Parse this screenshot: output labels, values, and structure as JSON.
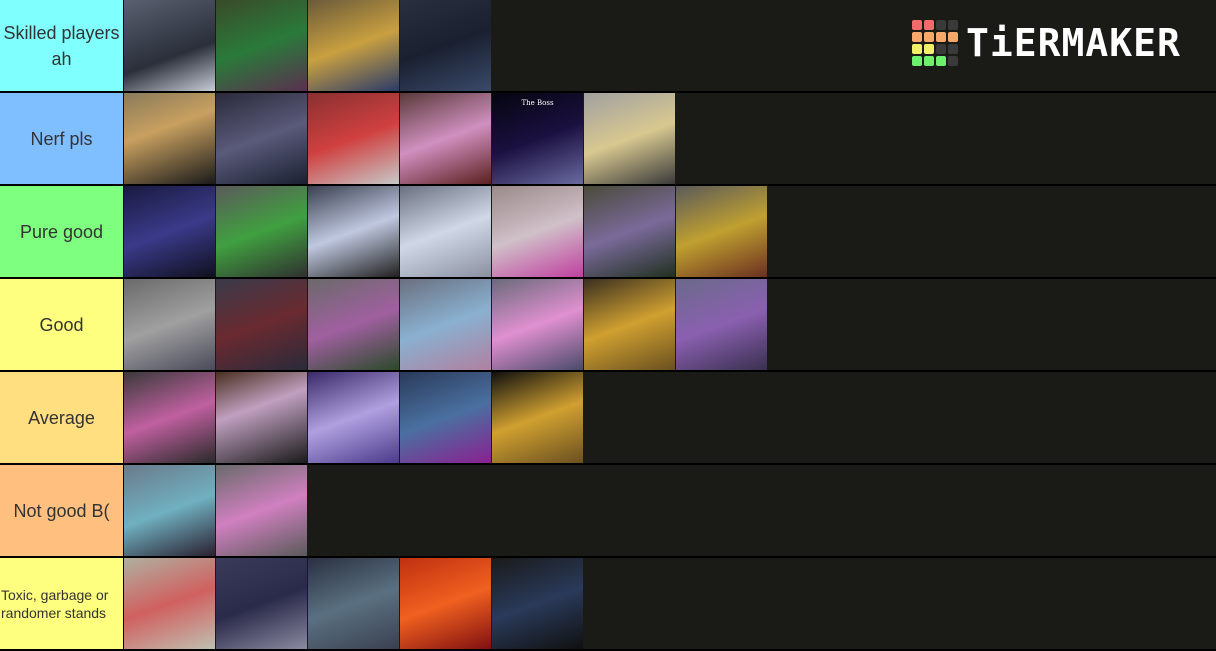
{
  "logo": {
    "text": "TiERMAKER",
    "grid_colors": [
      "#f26b6b",
      "#f26b6b",
      "#3a3a3a",
      "#3a3a3a",
      "#f7a86a",
      "#f7a86a",
      "#f7a86a",
      "#f7a86a",
      "#f2f06a",
      "#f2f06a",
      "#3a3a3a",
      "#3a3a3a",
      "#6df06d",
      "#6df06d",
      "#6df06d",
      "#3a3a3a"
    ]
  },
  "tiers": [
    {
      "label": "Skilled players ah",
      "color": "#80ffff",
      "items": [
        {
          "name": "stand-1",
          "bg": "linear-gradient(160deg,#5a6070,#2a2f3a 60%,#c8ccd6)"
        },
        {
          "name": "stand-2",
          "bg": "linear-gradient(160deg,#3a4a2a,#2a7a3a 50%,#5a3050)"
        },
        {
          "name": "stand-3",
          "bg": "linear-gradient(160deg,#6a5a3a,#c9a040 50%,#2a3a6a)"
        },
        {
          "name": "stand-4",
          "bg": "linear-gradient(160deg,#2a2f40,#1a2030 50%,#3a4a6a)"
        }
      ]
    },
    {
      "label": "Nerf pls",
      "color": "#80bfff",
      "items": [
        {
          "name": "stand-5",
          "bg": "linear-gradient(160deg,#8a7a5a,#c8a060 40%,#1a1a1a)"
        },
        {
          "name": "stand-6",
          "bg": "linear-gradient(160deg,#2a2a3a,#5a5a7a 50%,#1a2030)"
        },
        {
          "name": "stand-7",
          "bg": "linear-gradient(160deg,#8a3030,#d04040 50%,#c8c8c8)"
        },
        {
          "name": "stand-8",
          "bg": "linear-gradient(160deg,#5a3a3a,#d090c0 50%,#5a2020)"
        },
        {
          "name": "stand-9",
          "bg": "linear-gradient(160deg,#05050f,#1a1040 50%,#6a6aa0)",
          "caption": "The Boss"
        },
        {
          "name": "stand-10",
          "bg": "linear-gradient(160deg,#a0a0a0,#d8c890 50%,#3a3a3a)"
        }
      ]
    },
    {
      "label": "Pure good",
      "color": "#7fff7f",
      "items": [
        {
          "name": "stand-11",
          "bg": "linear-gradient(160deg,#1a1a40,#3a3a8a 50%,#101020)"
        },
        {
          "name": "stand-12",
          "bg": "linear-gradient(160deg,#5a5a5a,#40a040 50%,#303030)"
        },
        {
          "name": "stand-13",
          "bg": "linear-gradient(160deg,#3a4050,#c0c8e0 50%,#202020)"
        },
        {
          "name": "stand-14",
          "bg": "linear-gradient(160deg,#6a7080,#d0d8e8 50%,#8a90a0)"
        },
        {
          "name": "stand-15",
          "bg": "linear-gradient(160deg,#9a8a8a,#d0c0c8 50%,#c040a0)"
        },
        {
          "name": "stand-16",
          "bg": "linear-gradient(160deg,#4a4a3a,#7a6a9a 50%,#203020)"
        },
        {
          "name": "stand-17",
          "bg": "linear-gradient(160deg,#5a5a5a,#c0a030 50%,#6a3020)"
        }
      ]
    },
    {
      "label": "Good",
      "color": "#ffff7f",
      "items": [
        {
          "name": "stand-18",
          "bg": "linear-gradient(160deg,#6a6a6a,#a0a0a0 50%,#4a4a5a)"
        },
        {
          "name": "stand-19",
          "bg": "linear-gradient(160deg,#3a3a4a,#6a2a30 50%,#2a2a3a)"
        },
        {
          "name": "stand-20",
          "bg": "linear-gradient(160deg,#6a6a6a,#a060a0 50%,#2a4a2a)"
        },
        {
          "name": "stand-21",
          "bg": "linear-gradient(160deg,#6a7080,#8ab0d0 50%,#b080a0)"
        },
        {
          "name": "stand-22",
          "bg": "linear-gradient(160deg,#6a6a7a,#e090d0 50%,#4a4a6a)"
        },
        {
          "name": "stand-23",
          "bg": "linear-gradient(160deg,#3a3020,#d0a030 50%,#6a5020)"
        },
        {
          "name": "stand-24",
          "bg": "linear-gradient(160deg,#6a6a8a,#8a60b0 50%,#3a3050)"
        }
      ]
    },
    {
      "label": "Average",
      "color": "#ffdf80",
      "items": [
        {
          "name": "stand-25",
          "bg": "linear-gradient(160deg,#3a3a3a,#c060a0 50%,#2a2a2a)"
        },
        {
          "name": "stand-26",
          "bg": "linear-gradient(160deg,#4a3020,#c0a0c0 40%,#1a1a1a)"
        },
        {
          "name": "stand-27",
          "bg": "linear-gradient(160deg,#3a2a6a,#b0a0e0 50%,#4a3a8a)"
        },
        {
          "name": "stand-28",
          "bg": "linear-gradient(160deg,#2a3a5a,#4a70a0 50%,#8a2090)"
        },
        {
          "name": "stand-29",
          "bg": "linear-gradient(160deg,#101010,#d0a030 50%,#6a5020)"
        }
      ]
    },
    {
      "label": "Not good B(",
      "color": "#ffbf7f",
      "items": [
        {
          "name": "stand-30",
          "bg": "linear-gradient(160deg,#6a7a8a,#70b0c0 50%,#2a2030)"
        },
        {
          "name": "stand-31",
          "bg": "linear-gradient(160deg,#6a6a6a,#d080c0 50%,#5a5a5a)"
        }
      ]
    },
    {
      "label": "Toxic, garbage or randomer stands",
      "color": "#ffff7f",
      "small": true,
      "items": [
        {
          "name": "stand-32",
          "bg": "linear-gradient(160deg,#b0b0a0,#d06060 50%,#c0c0b0)"
        },
        {
          "name": "stand-33",
          "bg": "linear-gradient(160deg,#3a3a5a,#2a2a4a 50%,#8a8aa0)"
        },
        {
          "name": "stand-34",
          "bg": "linear-gradient(160deg,#2a3040,#5a7080 50%,#3a4050)"
        },
        {
          "name": "stand-35",
          "bg": "linear-gradient(160deg,#c03010,#f06020 50%,#801010)"
        },
        {
          "name": "stand-36",
          "bg": "linear-gradient(160deg,#1a1a1a,#2a3a5a 50%,#101010)"
        }
      ]
    }
  ]
}
